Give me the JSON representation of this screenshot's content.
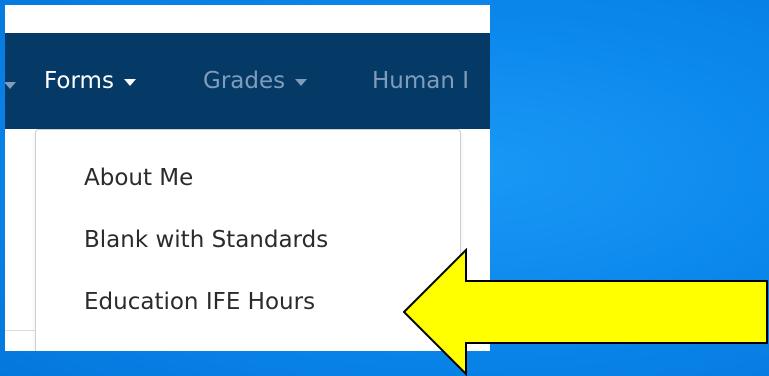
{
  "navbar": {
    "items": [
      {
        "label": "Forms",
        "active": true
      },
      {
        "label": "Grades",
        "active": false
      },
      {
        "label": "Human I",
        "active": false
      }
    ]
  },
  "dropdown": {
    "items": [
      {
        "label": "About Me"
      },
      {
        "label": "Blank with Standards"
      },
      {
        "label": "Education IFE Hours"
      }
    ]
  },
  "colors": {
    "slide_background": "#0b87ec",
    "navbar": "#053a66",
    "nav_active_text": "#ffffff",
    "nav_inactive_text": "#7f9dbb",
    "arrow_fill": "#ffff00",
    "arrow_stroke": "#000000"
  },
  "annotation": {
    "icon": "yellow-left-arrow-icon"
  }
}
